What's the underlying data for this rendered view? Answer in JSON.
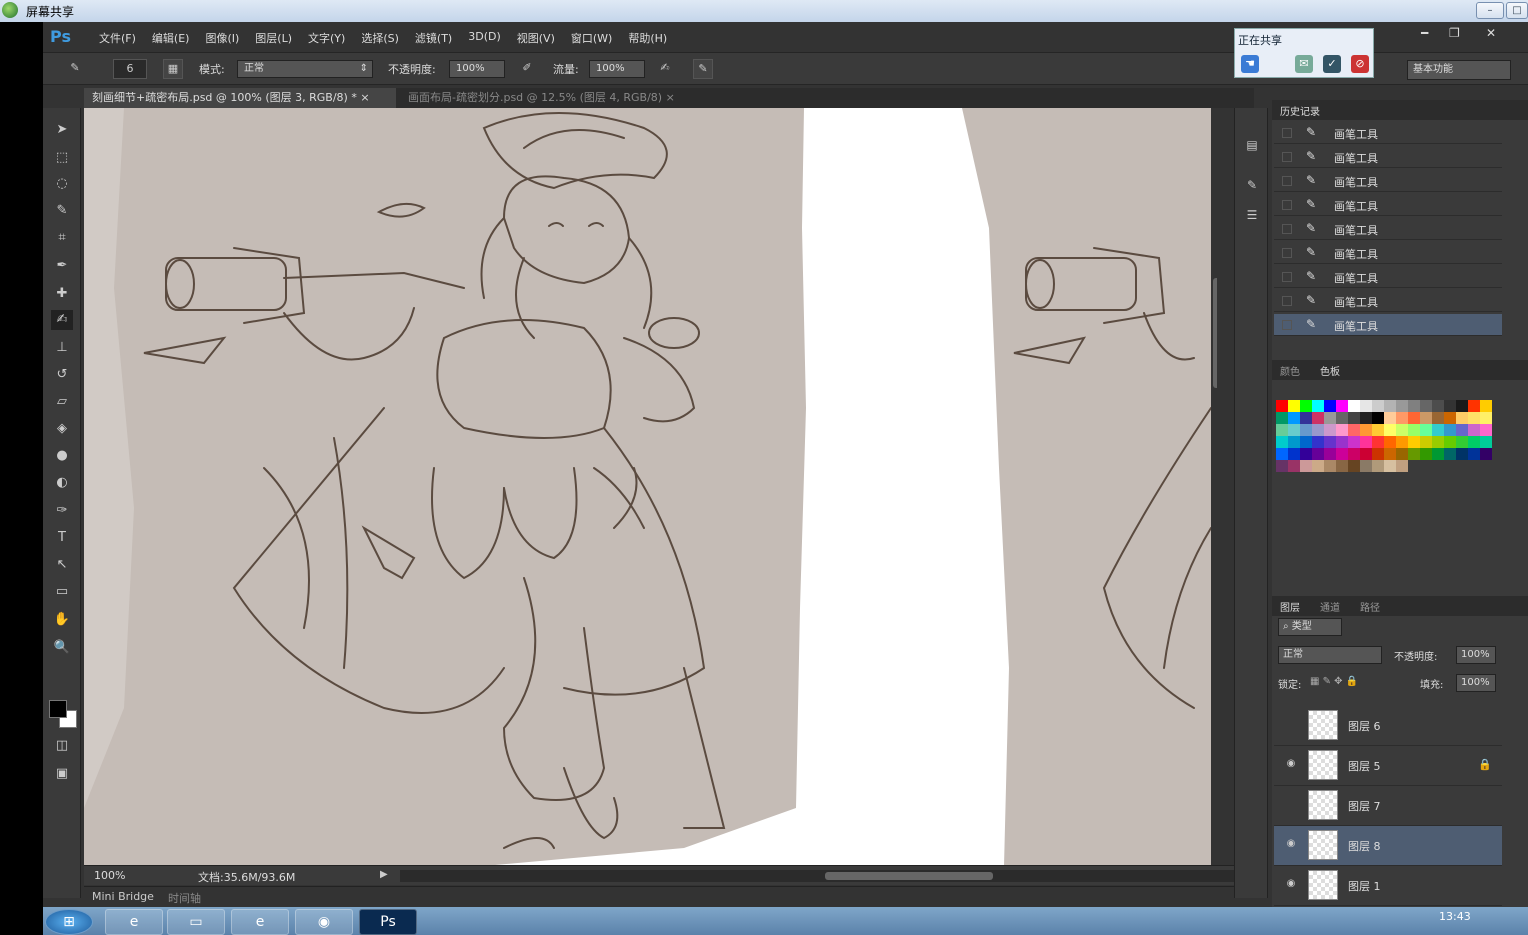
{
  "share": {
    "title": "屏幕共享",
    "panel_title": "正在共享"
  },
  "app": {
    "logo": "Ps",
    "menus": [
      "文件(F)",
      "编辑(E)",
      "图像(I)",
      "图层(L)",
      "文字(Y)",
      "选择(S)",
      "滤镜(T)",
      "3D(D)",
      "视图(V)",
      "窗口(W)",
      "帮助(H)"
    ],
    "workspace": "基本功能"
  },
  "options": {
    "brush_size": "6",
    "mode_label": "模式:",
    "mode_value": "正常",
    "opacity_label": "不透明度:",
    "opacity_value": "100%",
    "flow_label": "流量:",
    "flow_value": "100%"
  },
  "tabs": [
    {
      "label": "刻画细节+疏密布局.psd @ 100% (图层 3, RGB/8) *",
      "close": "×"
    },
    {
      "label": "画面布局-疏密划分.psd @ 12.5% (图层 4, RGB/8)",
      "close": "×"
    }
  ],
  "status": {
    "zoom": "100%",
    "doc": "文档:35.6M/93.6M"
  },
  "minibridge": {
    "label": "Mini Bridge",
    "timeline": "时间轴"
  },
  "history": {
    "tab": "历史记录",
    "items": [
      "画笔工具",
      "画笔工具",
      "画笔工具",
      "画笔工具",
      "画笔工具",
      "画笔工具",
      "画笔工具",
      "画笔工具",
      "画笔工具"
    ]
  },
  "swatches": {
    "tabs": [
      "颜色",
      "色板"
    ]
  },
  "layers": {
    "tabs": [
      "图层",
      "通道",
      "路径"
    ],
    "kind": "类型",
    "blend": "正常",
    "opacity_label": "不透明度:",
    "opacity_value": "100%",
    "lock_label": "锁定:",
    "fill_label": "填充:",
    "fill_value": "100%",
    "items": [
      {
        "name": "图层 6",
        "visible": false,
        "locked": false
      },
      {
        "name": "图层 5",
        "visible": true,
        "locked": true
      },
      {
        "name": "图层 7",
        "visible": false,
        "locked": false
      },
      {
        "name": "图层 8",
        "visible": true,
        "locked": false
      },
      {
        "name": "图层 1",
        "visible": true,
        "locked": false
      }
    ]
  },
  "taskbar": {
    "time": "13:43"
  },
  "colors": {
    "canvas_fill": "#c5bcb6",
    "line": "#5b4b40",
    "selection": "#4e5d72",
    "accent": "#3f9be0"
  }
}
